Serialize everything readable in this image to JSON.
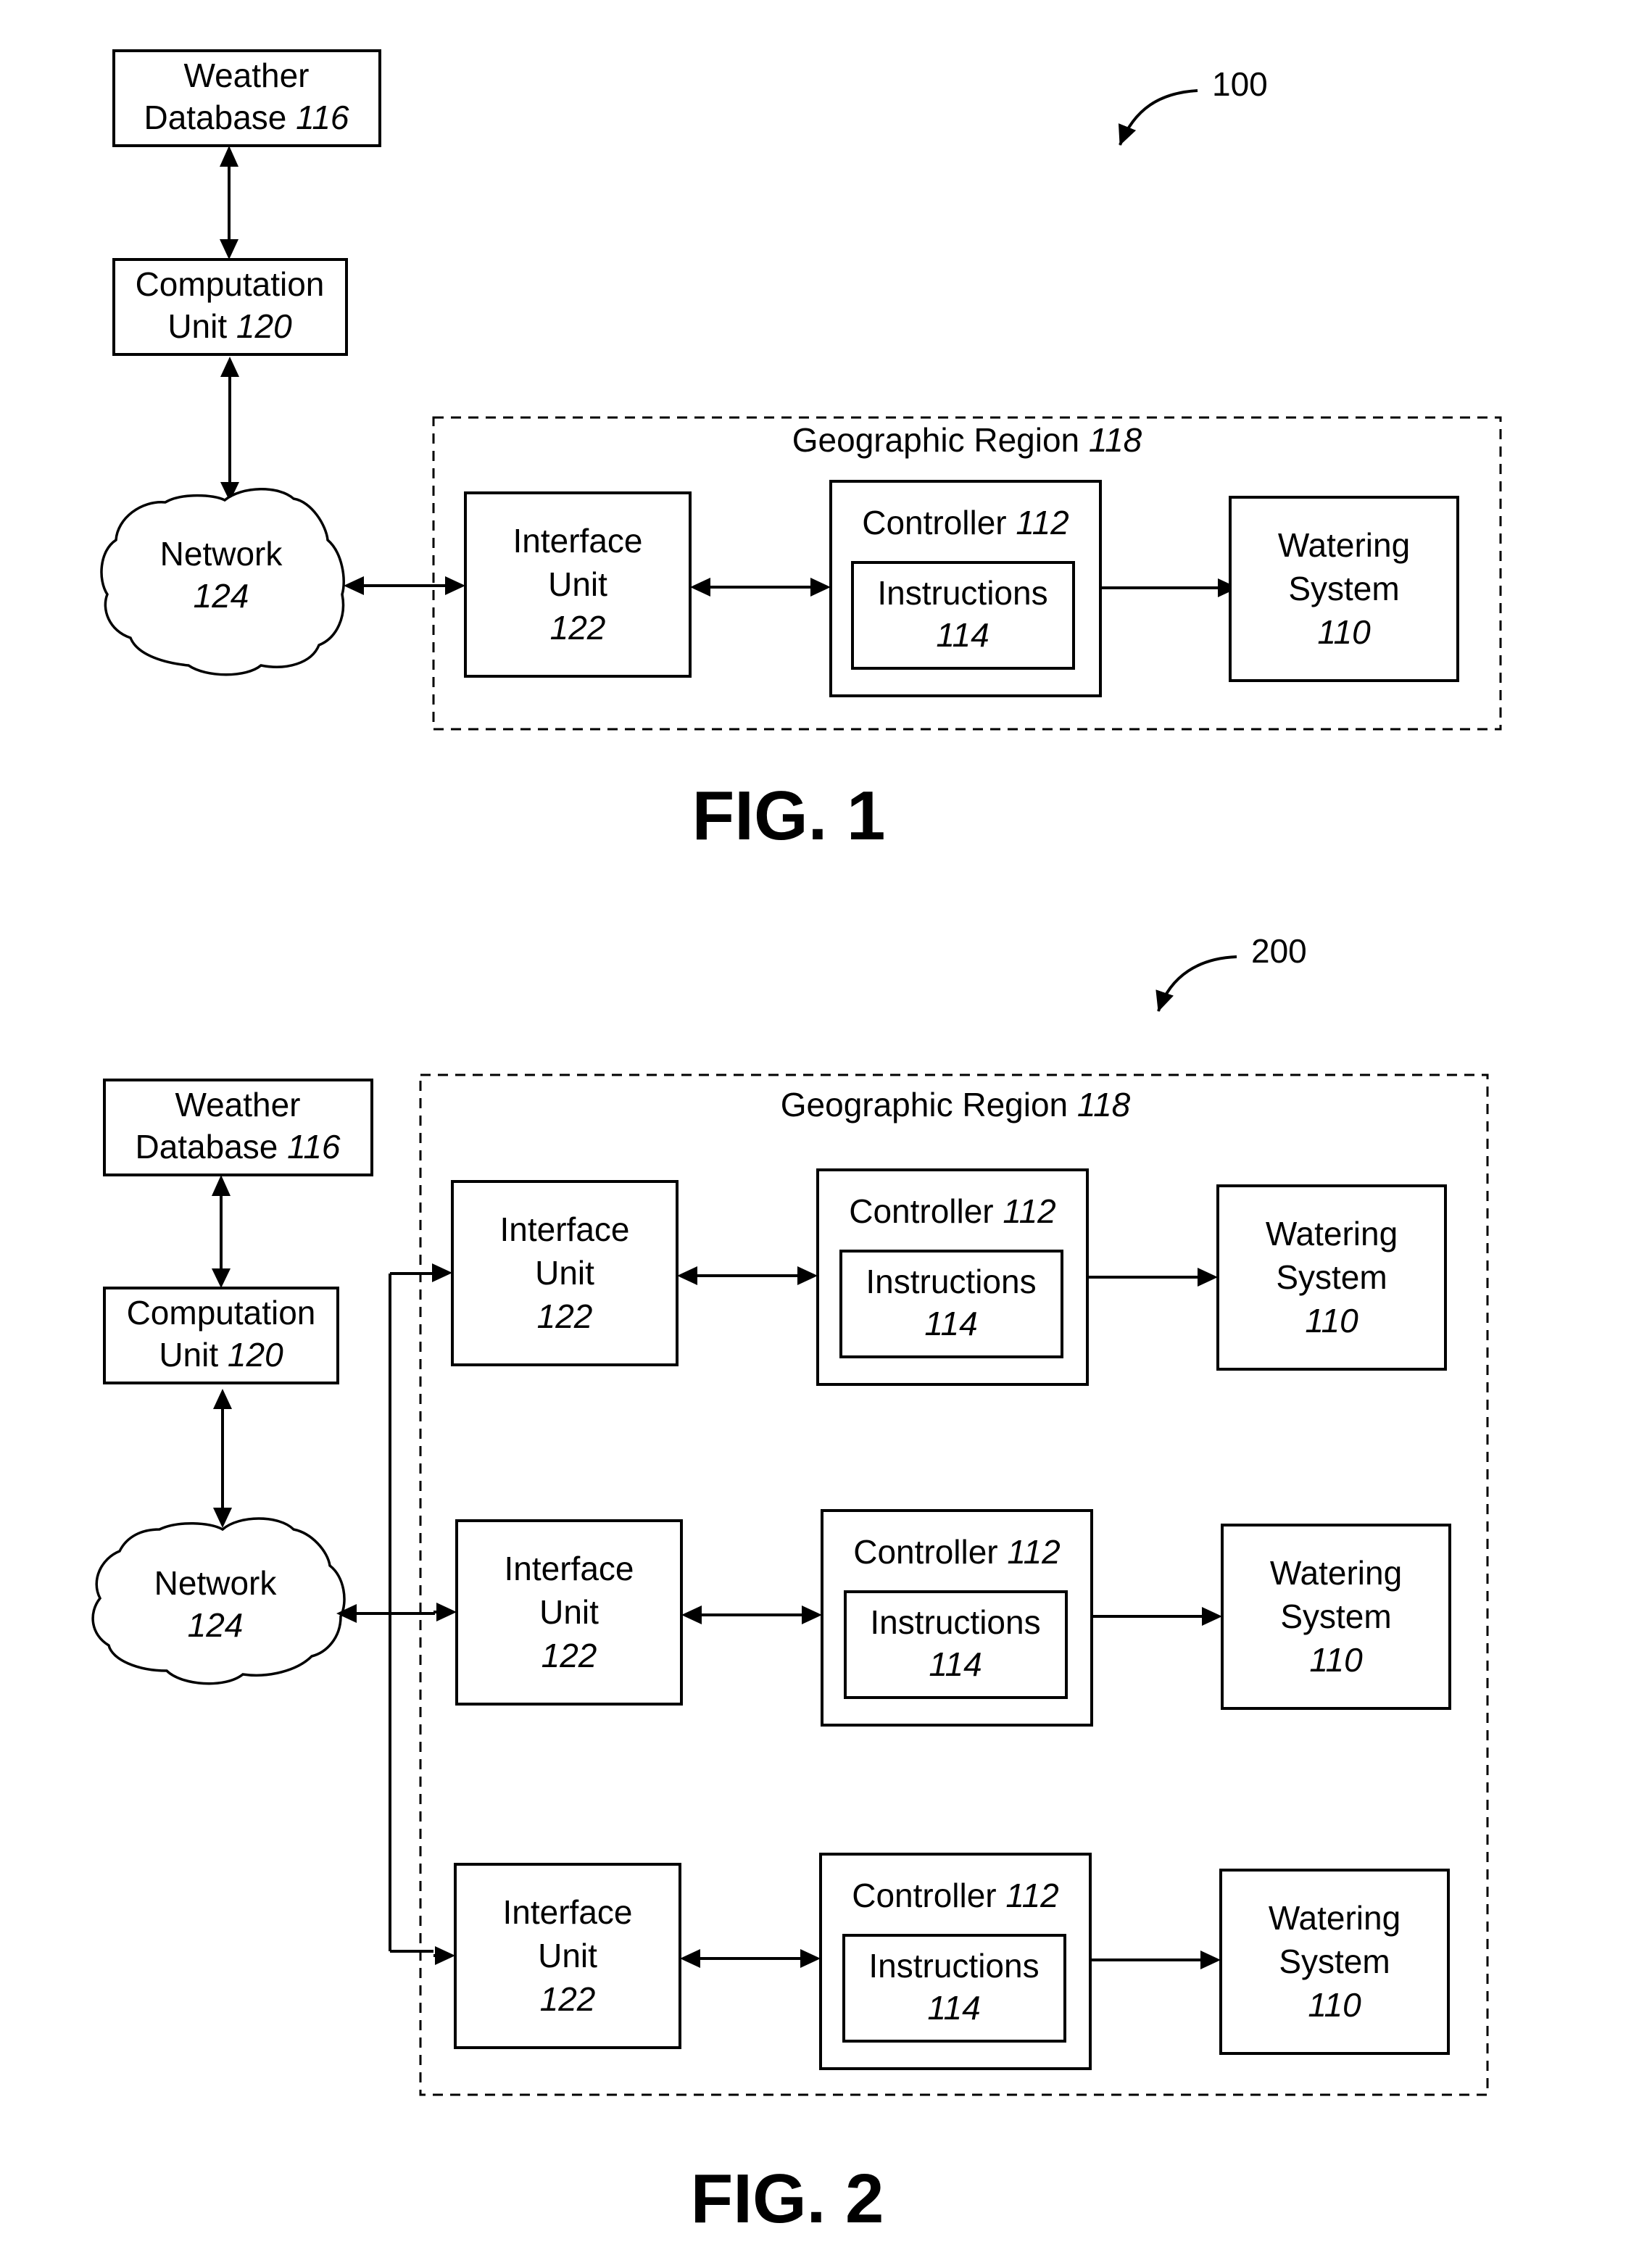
{
  "fig1": {
    "caption": "FIG. 1",
    "ref_number": "100",
    "weather_db": {
      "name": "Weather",
      "name2": "Database",
      "num": "116"
    },
    "computation": {
      "name": "Computation",
      "name2": "Unit",
      "num": "120"
    },
    "network": {
      "name": "Network",
      "num": "124"
    },
    "region": {
      "name": "Geographic Region",
      "num": "118"
    },
    "interface": {
      "name": "Interface",
      "name2": "Unit",
      "num": "122"
    },
    "controller": {
      "name": "Controller",
      "num": "112"
    },
    "instructions": {
      "name": "Instructions",
      "num": "114"
    },
    "watering": {
      "name": "Watering",
      "name2": "System",
      "num": "110"
    }
  },
  "fig2": {
    "caption": "FIG. 2",
    "ref_number": "200",
    "weather_db": {
      "name": "Weather",
      "name2": "Database",
      "num": "116"
    },
    "computation": {
      "name": "Computation",
      "name2": "Unit",
      "num": "120"
    },
    "network": {
      "name": "Network",
      "num": "124"
    },
    "region": {
      "name": "Geographic Region",
      "num": "118"
    },
    "rows": [
      {
        "interface": {
          "name": "Interface",
          "name2": "Unit",
          "num": "122"
        },
        "controller": {
          "name": "Controller",
          "num": "112"
        },
        "instructions": {
          "name": "Instructions",
          "num": "114"
        },
        "watering": {
          "name": "Watering",
          "name2": "System",
          "num": "110"
        }
      },
      {
        "interface": {
          "name": "Interface",
          "name2": "Unit",
          "num": "122"
        },
        "controller": {
          "name": "Controller",
          "num": "112"
        },
        "instructions": {
          "name": "Instructions",
          "num": "114"
        },
        "watering": {
          "name": "Watering",
          "name2": "System",
          "num": "110"
        }
      },
      {
        "interface": {
          "name": "Interface",
          "name2": "Unit",
          "num": "122"
        },
        "controller": {
          "name": "Controller",
          "num": "112"
        },
        "instructions": {
          "name": "Instructions",
          "num": "114"
        },
        "watering": {
          "name": "Watering",
          "name2": "System",
          "num": "110"
        }
      }
    ]
  }
}
